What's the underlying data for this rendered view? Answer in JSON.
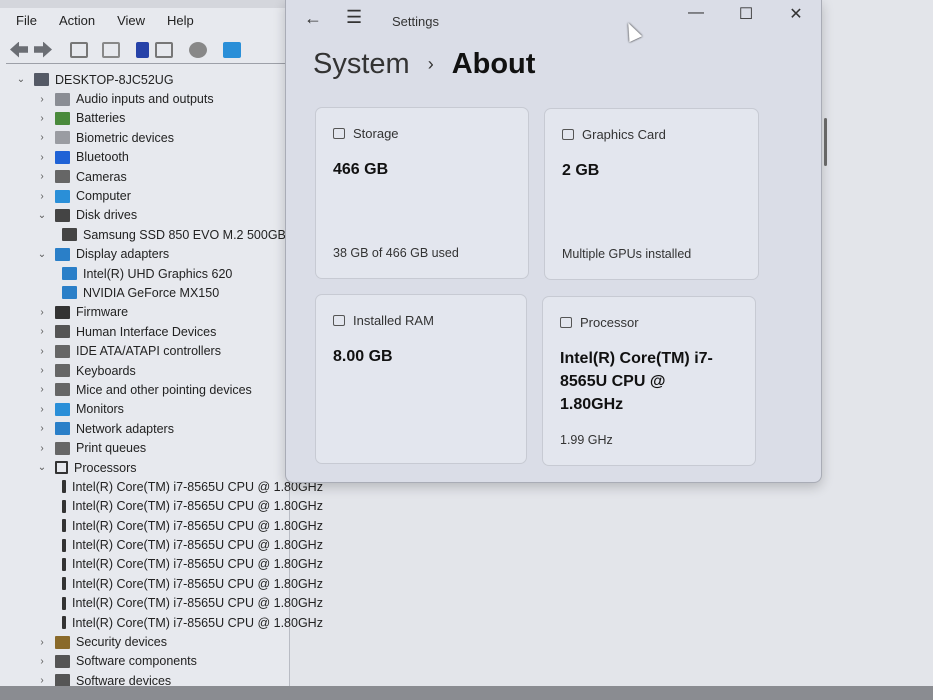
{
  "device_manager": {
    "menu": [
      "File",
      "Action",
      "View",
      "Help"
    ],
    "toolbar_icons": [
      "back-icon",
      "forward-icon",
      "properties-icon",
      "update-driver-icon",
      "help-icon",
      "view-icon",
      "scan-hardware-icon",
      "monitor-icon"
    ],
    "tree": [
      {
        "label": "DESKTOP-8JC52UG",
        "level": 0,
        "state": "expanded",
        "icon": "computer-network-icon",
        "color": "#555a66"
      },
      {
        "label": "Audio inputs and outputs",
        "level": 1,
        "state": "collapsed",
        "icon": "speaker-icon",
        "color": "#8a8d94"
      },
      {
        "label": "Batteries",
        "level": 1,
        "state": "collapsed",
        "icon": "battery-icon",
        "color": "#4a8a3c"
      },
      {
        "label": "Biometric devices",
        "level": 1,
        "state": "collapsed",
        "icon": "fingerprint-icon",
        "color": "#9a9ca2"
      },
      {
        "label": "Bluetooth",
        "level": 1,
        "state": "collapsed",
        "icon": "bluetooth-icon",
        "color": "#1f62d6"
      },
      {
        "label": "Cameras",
        "level": 1,
        "state": "collapsed",
        "icon": "camera-icon",
        "color": "#666"
      },
      {
        "label": "Computer",
        "level": 1,
        "state": "collapsed",
        "icon": "computer-icon",
        "color": "#2a8fd8"
      },
      {
        "label": "Disk drives",
        "level": 1,
        "state": "expanded",
        "icon": "disk-drive-icon",
        "color": "#444"
      },
      {
        "label": "Samsung SSD 850 EVO M.2 500GB",
        "level": 2,
        "icon": "disk-drive-icon",
        "color": "#444"
      },
      {
        "label": "Display adapters",
        "level": 1,
        "state": "expanded",
        "icon": "display-adapter-icon",
        "color": "#2a7fc8"
      },
      {
        "label": "Intel(R) UHD Graphics 620",
        "level": 2,
        "icon": "display-adapter-icon",
        "color": "#2a7fc8"
      },
      {
        "label": "NVIDIA GeForce MX150",
        "level": 2,
        "icon": "display-adapter-icon",
        "color": "#2a7fc8"
      },
      {
        "label": "Firmware",
        "level": 1,
        "state": "collapsed",
        "icon": "firmware-icon",
        "color": "#333"
      },
      {
        "label": "Human Interface Devices",
        "level": 1,
        "state": "collapsed",
        "icon": "hid-icon",
        "color": "#555"
      },
      {
        "label": "IDE ATA/ATAPI controllers",
        "level": 1,
        "state": "collapsed",
        "icon": "ide-controller-icon",
        "color": "#666"
      },
      {
        "label": "Keyboards",
        "level": 1,
        "state": "collapsed",
        "icon": "keyboard-icon",
        "color": "#666"
      },
      {
        "label": "Mice and other pointing devices",
        "level": 1,
        "state": "collapsed",
        "icon": "mouse-icon",
        "color": "#666"
      },
      {
        "label": "Monitors",
        "level": 1,
        "state": "collapsed",
        "icon": "monitor-icon",
        "color": "#2a8fd8"
      },
      {
        "label": "Network adapters",
        "level": 1,
        "state": "collapsed",
        "icon": "network-adapter-icon",
        "color": "#2a7fc8"
      },
      {
        "label": "Print queues",
        "level": 1,
        "state": "collapsed",
        "icon": "printer-icon",
        "color": "#666"
      },
      {
        "label": "Processors",
        "level": 1,
        "state": "expanded",
        "icon": "processor-icon",
        "color": "#333"
      },
      {
        "label": "Intel(R) Core(TM) i7-8565U CPU @ 1.80GHz",
        "level": 2,
        "icon": "processor-icon",
        "color": "#333"
      },
      {
        "label": "Intel(R) Core(TM) i7-8565U CPU @ 1.80GHz",
        "level": 2,
        "icon": "processor-icon",
        "color": "#333"
      },
      {
        "label": "Intel(R) Core(TM) i7-8565U CPU @ 1.80GHz",
        "level": 2,
        "icon": "processor-icon",
        "color": "#333"
      },
      {
        "label": "Intel(R) Core(TM) i7-8565U CPU @ 1.80GHz",
        "level": 2,
        "icon": "processor-icon",
        "color": "#333"
      },
      {
        "label": "Intel(R) Core(TM) i7-8565U CPU @ 1.80GHz",
        "level": 2,
        "icon": "processor-icon",
        "color": "#333"
      },
      {
        "label": "Intel(R) Core(TM) i7-8565U CPU @ 1.80GHz",
        "level": 2,
        "icon": "processor-icon",
        "color": "#333"
      },
      {
        "label": "Intel(R) Core(TM) i7-8565U CPU @ 1.80GHz",
        "level": 2,
        "icon": "processor-icon",
        "color": "#333"
      },
      {
        "label": "Intel(R) Core(TM) i7-8565U CPU @ 1.80GHz",
        "level": 2,
        "icon": "processor-icon",
        "color": "#333"
      },
      {
        "label": "Security devices",
        "level": 1,
        "state": "collapsed",
        "icon": "security-icon",
        "color": "#8a6a2a"
      },
      {
        "label": "Software components",
        "level": 1,
        "state": "collapsed",
        "icon": "software-component-icon",
        "color": "#555"
      },
      {
        "label": "Software devices",
        "level": 1,
        "state": "collapsed",
        "icon": "software-device-icon",
        "color": "#555"
      }
    ]
  },
  "settings": {
    "title": "Settings",
    "breadcrumb": {
      "parent": "System",
      "current": "About"
    },
    "cards": {
      "storage": {
        "label": "Storage",
        "value": "466 GB",
        "sub": "38 GB of 466 GB used"
      },
      "graphics": {
        "label": "Graphics Card",
        "value": "2 GB",
        "sub": "Multiple GPUs installed"
      },
      "ram": {
        "label": "Installed RAM",
        "value": "8.00 GB"
      },
      "processor": {
        "label": "Processor",
        "value": "Intel(R) Core(TM) i7-8565U CPU @ 1.80GHz",
        "sub": "1.99 GHz"
      }
    }
  }
}
